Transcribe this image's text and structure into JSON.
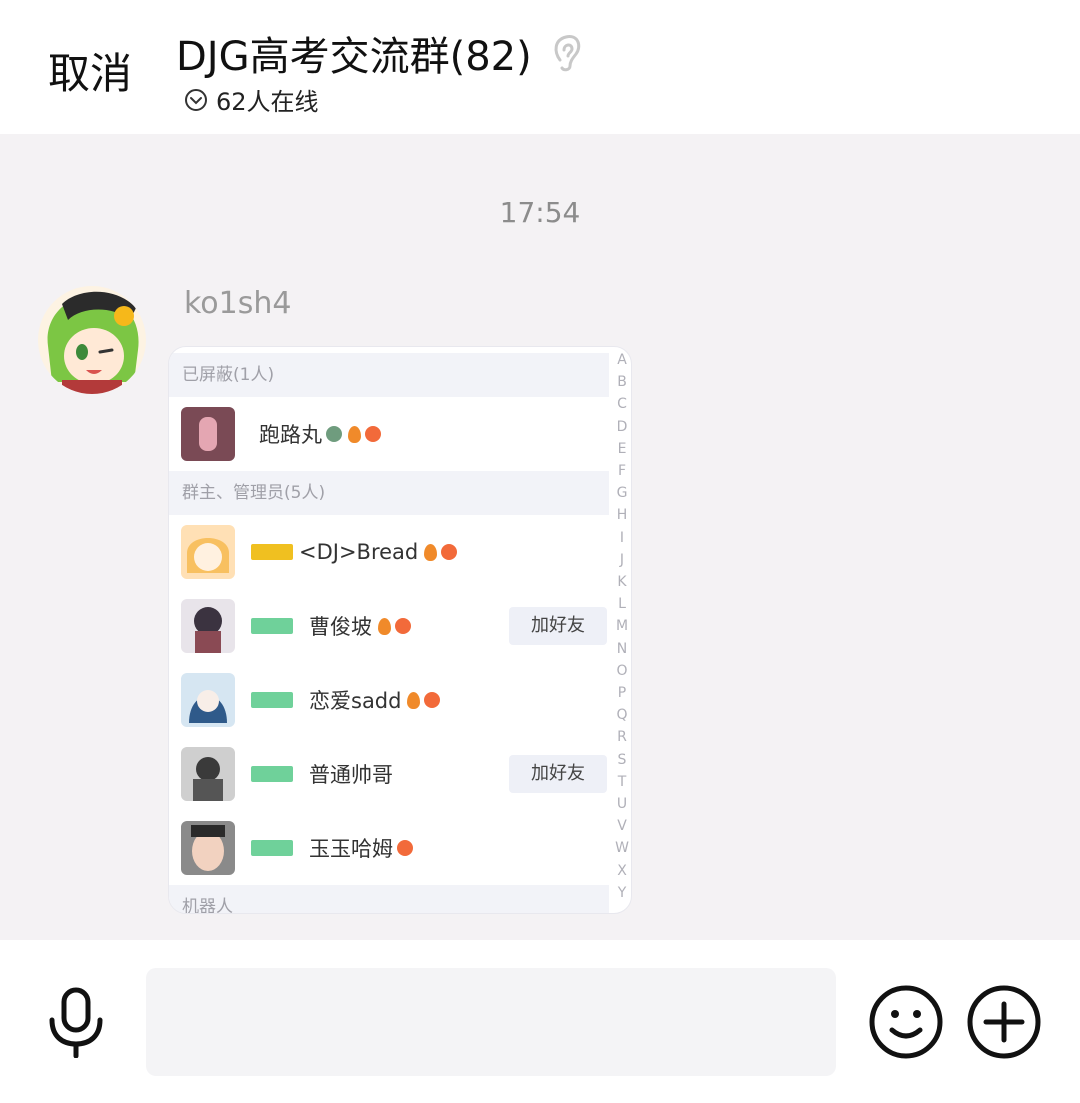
{
  "header": {
    "cancel_label": "取消",
    "title": "DJG高考交流群(82)",
    "online_text": "62人在线"
  },
  "chat": {
    "timestamp": "17:54",
    "sender_name": "ko1sh4",
    "screenshot": {
      "sections": [
        {
          "label": "已屏蔽(1人)"
        },
        {
          "label": "群主、管理员(5人)"
        },
        {
          "label": "机器人"
        }
      ],
      "members": [
        {
          "name": "跑路丸",
          "role": "",
          "add_label": ""
        },
        {
          "name": "<DJ>Bread",
          "role": "owner",
          "add_label": ""
        },
        {
          "name": "曹俊坡",
          "role": "admin",
          "add_label": "加好友"
        },
        {
          "name": "恋爱sadd",
          "role": "admin",
          "add_label": ""
        },
        {
          "name": "普通帅哥",
          "role": "admin",
          "add_label": "加好友"
        },
        {
          "name": "玉玉哈姆",
          "role": "admin",
          "add_label": ""
        }
      ],
      "index_letters": [
        "A",
        "B",
        "C",
        "D",
        "E",
        "F",
        "G",
        "H",
        "I",
        "J",
        "K",
        "L",
        "M",
        "N",
        "O",
        "P",
        "Q",
        "R",
        "S",
        "T",
        "U",
        "V",
        "W",
        "X",
        "Y"
      ]
    }
  },
  "input_bar": {
    "placeholder": "",
    "icons": [
      "microphone-icon",
      "smiley-icon",
      "plus-circle-icon"
    ]
  },
  "colors": {
    "header_bg": "#ffffff",
    "chat_bg": "#f4f2f4",
    "owner_badge": "#f0c020",
    "admin_badge": "#6fd19a"
  }
}
